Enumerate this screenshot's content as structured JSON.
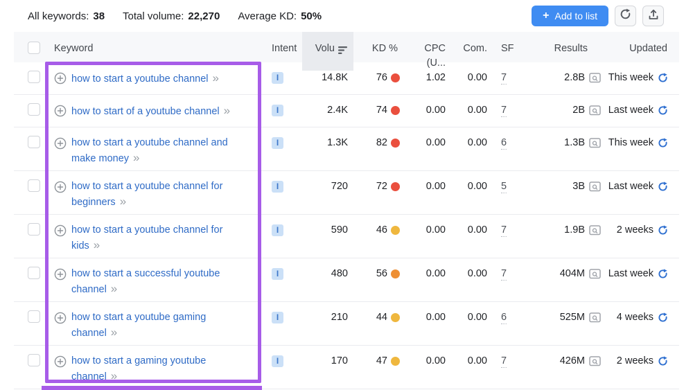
{
  "toolbar": {
    "all_keywords_label": "All keywords:",
    "all_keywords_value": "38",
    "total_volume_label": "Total volume:",
    "total_volume_value": "22,270",
    "average_kd_label": "Average KD:",
    "average_kd_value": "50%",
    "add_to_list_label": "Add to list",
    "add_to_list_plus": "+"
  },
  "table": {
    "columns": {
      "keyword": "Keyword",
      "intent": "Intent",
      "volume": "Volu",
      "kd": "KD %",
      "cpc": "CPC (U...",
      "com": "Com.",
      "sf": "SF",
      "results": "Results",
      "updated": "Updated"
    },
    "rows": [
      {
        "keyword_lines": [
          "how to start a youtube channel"
        ],
        "intent": "I",
        "volume": "14.8K",
        "kd": "76",
        "kd_level": "red",
        "cpc": "1.02",
        "com": "0.00",
        "sf": "7",
        "results": "2.8B",
        "updated": "This week"
      },
      {
        "keyword_lines": [
          "how to start of a youtube channel"
        ],
        "intent": "I",
        "volume": "2.4K",
        "kd": "74",
        "kd_level": "red",
        "cpc": "0.00",
        "com": "0.00",
        "sf": "7",
        "results": "2B",
        "updated": "Last week"
      },
      {
        "keyword_lines": [
          "how to start a youtube channel and",
          "make money"
        ],
        "intent": "I",
        "volume": "1.3K",
        "kd": "82",
        "kd_level": "red",
        "cpc": "0.00",
        "com": "0.00",
        "sf": "6",
        "results": "1.3B",
        "updated": "This week"
      },
      {
        "keyword_lines": [
          "how to start a youtube channel for",
          "beginners"
        ],
        "intent": "I",
        "volume": "720",
        "kd": "72",
        "kd_level": "red",
        "cpc": "0.00",
        "com": "0.00",
        "sf": "5",
        "results": "3B",
        "updated": "Last week"
      },
      {
        "keyword_lines": [
          "how to start a youtube channel for",
          "kids"
        ],
        "intent": "I",
        "volume": "590",
        "kd": "46",
        "kd_level": "yellow",
        "cpc": "0.00",
        "com": "0.00",
        "sf": "7",
        "results": "1.9B",
        "updated": "2 weeks"
      },
      {
        "keyword_lines": [
          "how to start a successful youtube",
          "channel"
        ],
        "intent": "I",
        "volume": "480",
        "kd": "56",
        "kd_level": "orange",
        "cpc": "0.00",
        "com": "0.00",
        "sf": "7",
        "results": "404M",
        "updated": "Last week"
      },
      {
        "keyword_lines": [
          "how to start a youtube gaming",
          "channel"
        ],
        "intent": "I",
        "volume": "210",
        "kd": "44",
        "kd_level": "yellow",
        "cpc": "0.00",
        "com": "0.00",
        "sf": "6",
        "results": "525M",
        "updated": "4 weeks"
      },
      {
        "keyword_lines": [
          "how to start a gaming youtube",
          "channel"
        ],
        "intent": "I",
        "volume": "170",
        "kd": "47",
        "kd_level": "yellow",
        "cpc": "0.00",
        "com": "0.00",
        "sf": "7",
        "results": "426M",
        "updated": "2 weeks"
      }
    ]
  },
  "colors": {
    "kd_red": "#ea4f3e",
    "kd_orange": "#ee8f34",
    "kd_yellow": "#efb73e",
    "accent_blue": "#3f8cf2",
    "link_blue": "#2f6bc6",
    "refresh_blue": "#2e6fd0",
    "highlight_purple": "#a75ce8"
  }
}
